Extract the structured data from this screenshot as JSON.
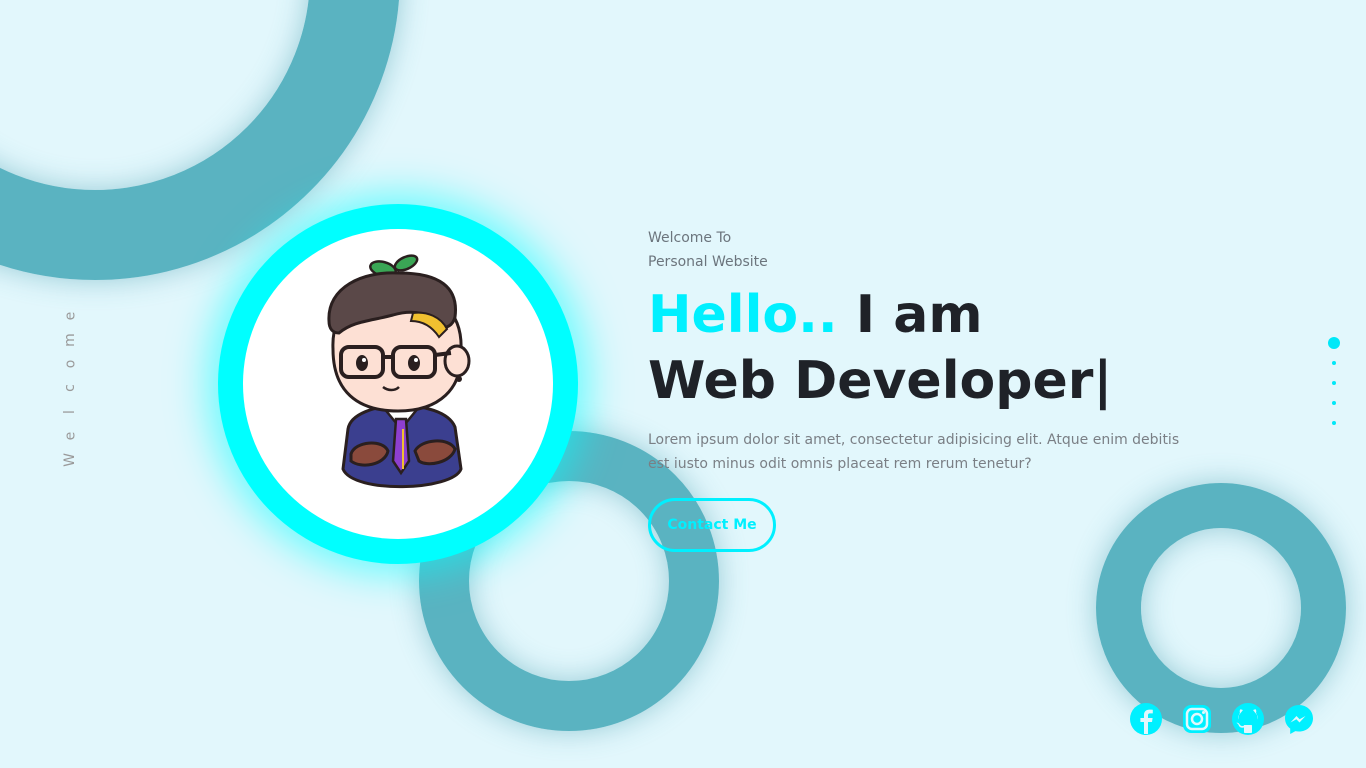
{
  "side": {
    "vertical_letters": [
      "W",
      "e",
      "l",
      "c",
      "o",
      "m",
      "e"
    ]
  },
  "hero": {
    "eyebrow_line1": "Welcome To",
    "eyebrow_line2": "Personal Website",
    "greeting": "Hello..",
    "intro": "I am",
    "role": "Web Developer|",
    "description": "Lorem ipsum dolor sit amet, consectetur adipisicing elit. Atque enim debitis est iusto minus odit omnis placeat rem rerum tenetur?",
    "cta_label": "Contact Me"
  },
  "pagination": {
    "count": 5,
    "active_index": 0
  },
  "socials": [
    {
      "name": "facebook-icon"
    },
    {
      "name": "instagram-icon"
    },
    {
      "name": "github-icon"
    },
    {
      "name": "messenger-icon"
    }
  ],
  "colors": {
    "background": "#e2f7fc",
    "accent": "#00f0ff",
    "ring": "#5ab3c1",
    "heading": "#1f2228",
    "muted": "#6c757d"
  }
}
